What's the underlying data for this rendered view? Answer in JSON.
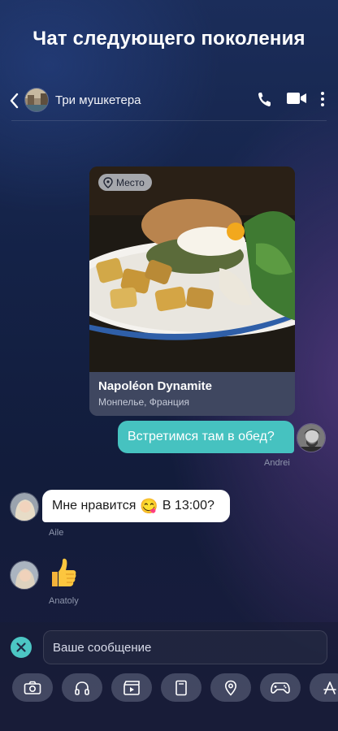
{
  "headline": "Чат следующего поколения",
  "topbar": {
    "title": "Три мушкетера",
    "icons": [
      "back-icon",
      "phone-icon",
      "video-camera-icon",
      "more-vertical-icon"
    ]
  },
  "place_card": {
    "badge": "Место",
    "name": "Napoléon Dynamite",
    "location": "Монпелье, Франция"
  },
  "messages": [
    {
      "direction": "outgoing",
      "text": "Встретимся там в обед?",
      "sender": "Andrei"
    },
    {
      "direction": "incoming",
      "text_before": "Мне нравится",
      "emoji": "😋",
      "text_after": "В 13:00?",
      "sender": "Aile"
    },
    {
      "direction": "incoming",
      "emoji": "thumbs-up",
      "sender": "Anatoly"
    }
  ],
  "composer": {
    "placeholder": "Ваше сообщение",
    "tools": [
      "camera-icon",
      "headphones-icon",
      "video-clip-icon",
      "document-icon",
      "location-pin-icon",
      "gamepad-icon",
      "app-store-icon"
    ]
  },
  "colors": {
    "accent": "#46c2c0",
    "incoming_bubble": "#ffffff",
    "card": "#3f4760"
  }
}
